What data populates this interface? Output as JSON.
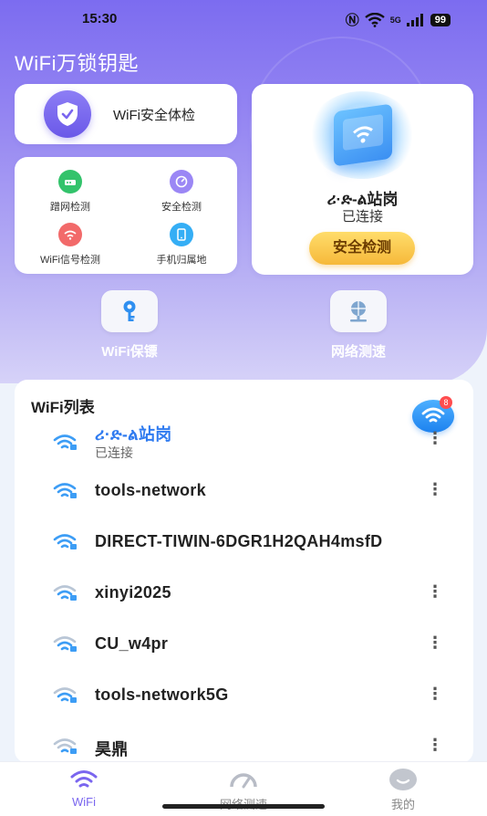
{
  "status_bar": {
    "time": "15:30",
    "network": "5G",
    "battery": "99"
  },
  "app": {
    "title": "WiFi万锁钥匙"
  },
  "security_check": {
    "label": "WiFi安全体检"
  },
  "tools": [
    {
      "label": "蹭网检测",
      "icon": "router-icon",
      "color": "#33c36b"
    },
    {
      "label": "安全检测",
      "icon": "gauge-icon",
      "color": "#9b87f5"
    },
    {
      "label": "WiFi信号检测",
      "icon": "signal-icon",
      "color": "#f26a6a"
    },
    {
      "label": "手机归属地",
      "icon": "phone-icon",
      "color": "#35aef5"
    }
  ],
  "device": {
    "name": "ሪ·ድ-ል站岗",
    "status": "已连接",
    "button": "安全检测"
  },
  "quick_actions": [
    {
      "label": "WiFi保镖",
      "icon": "key-icon"
    },
    {
      "label": "网络测速",
      "icon": "network-globe-icon"
    }
  ],
  "wifi_list": {
    "title": "WiFi列表",
    "badge": "8",
    "items": [
      {
        "name": "ሪ·ድ-ል站岗",
        "status": "已连接",
        "connected": true,
        "locked": true
      },
      {
        "name": "tools-network",
        "status": "",
        "connected": false,
        "locked": true
      },
      {
        "name": "DIRECT-TIWIN-6DGR1H2QAH4msfD",
        "status": "",
        "connected": false,
        "locked": true
      },
      {
        "name": "xinyi2025",
        "status": "",
        "connected": false,
        "locked": true
      },
      {
        "name": "CU_w4pr",
        "status": "",
        "connected": false,
        "locked": true
      },
      {
        "name": "tools-network5G",
        "status": "",
        "connected": false,
        "locked": true
      },
      {
        "name": "昊鼎",
        "status": "",
        "connected": false,
        "locked": true
      }
    ]
  },
  "bottom_nav": [
    {
      "label": "WiFi",
      "icon": "wifi-icon",
      "active": true
    },
    {
      "label": "网络测速",
      "icon": "speedometer-icon",
      "active": false
    },
    {
      "label": "我的",
      "icon": "profile-icon",
      "active": false
    }
  ],
  "colors": {
    "accent": "#7a66ef",
    "connected_name": "#2f7bf0",
    "button_yellow": "#f6b93a"
  }
}
